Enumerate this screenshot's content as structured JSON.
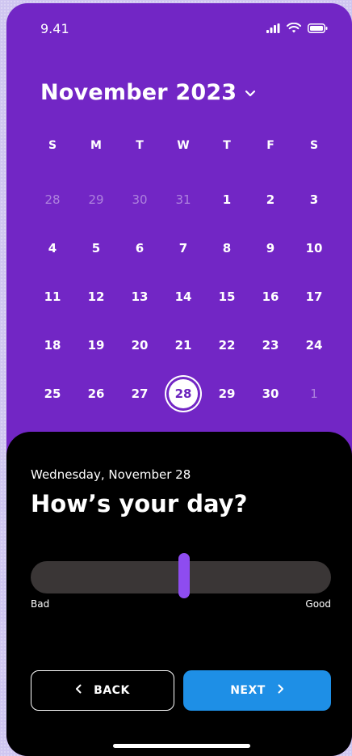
{
  "status_bar": {
    "time": "9.41",
    "icons": [
      "signal-icon",
      "wifi-icon",
      "battery-icon"
    ]
  },
  "calendar": {
    "month_title": "November 2023",
    "dropdown_icon": "chevron-down-icon",
    "weekdays": [
      "S",
      "M",
      "T",
      "W",
      "T",
      "F",
      "S"
    ],
    "weeks": [
      [
        {
          "day": "28",
          "muted": true
        },
        {
          "day": "29",
          "muted": true
        },
        {
          "day": "30",
          "muted": true
        },
        {
          "day": "31",
          "muted": true
        },
        {
          "day": "1"
        },
        {
          "day": "2"
        },
        {
          "day": "3"
        }
      ],
      [
        {
          "day": "4"
        },
        {
          "day": "5"
        },
        {
          "day": "6"
        },
        {
          "day": "7"
        },
        {
          "day": "8"
        },
        {
          "day": "9"
        },
        {
          "day": "10"
        }
      ],
      [
        {
          "day": "11"
        },
        {
          "day": "12"
        },
        {
          "day": "13"
        },
        {
          "day": "14"
        },
        {
          "day": "15"
        },
        {
          "day": "16"
        },
        {
          "day": "17"
        }
      ],
      [
        {
          "day": "18"
        },
        {
          "day": "19"
        },
        {
          "day": "20"
        },
        {
          "day": "21"
        },
        {
          "day": "22"
        },
        {
          "day": "23"
        },
        {
          "day": "24"
        }
      ],
      [
        {
          "day": "25"
        },
        {
          "day": "26"
        },
        {
          "day": "27"
        },
        {
          "day": "28",
          "selected": true
        },
        {
          "day": "29"
        },
        {
          "day": "30"
        },
        {
          "day": "1",
          "muted": true
        }
      ]
    ],
    "selected_day": "28"
  },
  "mood": {
    "date_label": "Wednesday,  November 28",
    "question": "How’s your day?",
    "slider_min_label": "Bad",
    "slider_max_label": "Good",
    "slider_value": 0.51
  },
  "actions": {
    "back_label": "BACK",
    "next_label": "NEXT"
  },
  "colors": {
    "background": "#7226c5",
    "accent": "#8e4cf0",
    "primary_button": "#1e8fe6",
    "sheet": "#000000",
    "track": "#3a3636"
  }
}
